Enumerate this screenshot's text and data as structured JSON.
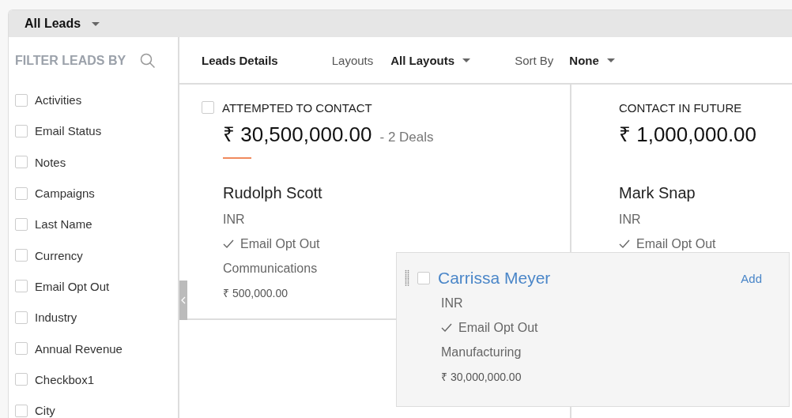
{
  "view_selector": {
    "label": "All Leads"
  },
  "filter": {
    "title": "FILTER LEADS BY",
    "items": [
      {
        "label": "Activities",
        "checked": false
      },
      {
        "label": "Email Status",
        "checked": false
      },
      {
        "label": "Notes",
        "checked": false
      },
      {
        "label": "Campaigns",
        "checked": false
      },
      {
        "label": "Last Name",
        "checked": false
      },
      {
        "label": "Currency",
        "checked": false
      },
      {
        "label": "Email Opt Out",
        "checked": false
      },
      {
        "label": "Industry",
        "checked": false
      },
      {
        "label": "Annual Revenue",
        "checked": false
      },
      {
        "label": "Checkbox1",
        "checked": false
      },
      {
        "label": "City",
        "checked": false
      }
    ]
  },
  "toolbar": {
    "title": "Leads Details",
    "layouts_label": "Layouts",
    "layouts_value": "All Layouts",
    "sort_label": "Sort By",
    "sort_value": "None"
  },
  "columns": [
    {
      "title": "ATTEMPTED TO CONTACT",
      "checked": false,
      "highlighted": true,
      "total": "₹ 30,500,000.00",
      "deals": "- 2 Deals",
      "cards": [
        {
          "name": "Rudolph Scott",
          "currency": "INR",
          "opt_out": "Email Opt Out",
          "opted_out": true,
          "industry": "Communications",
          "revenue": "₹ 500,000.00"
        }
      ]
    },
    {
      "title": "CONTACT IN FUTURE",
      "highlighted": false,
      "total": "₹ 1,000,000.00",
      "cards": [
        {
          "name": "Mark Snap",
          "currency": "INR",
          "opt_out": "Email Opt Out",
          "opted_out": true
        }
      ]
    }
  ],
  "dragged_card": {
    "name": "Carrissa Meyer",
    "checked": false,
    "action": "Add",
    "currency": "INR",
    "opt_out": "Email Opt Out",
    "opted_out": true,
    "industry": "Manufacturing",
    "revenue": "₹ 30,000,000.00"
  }
}
